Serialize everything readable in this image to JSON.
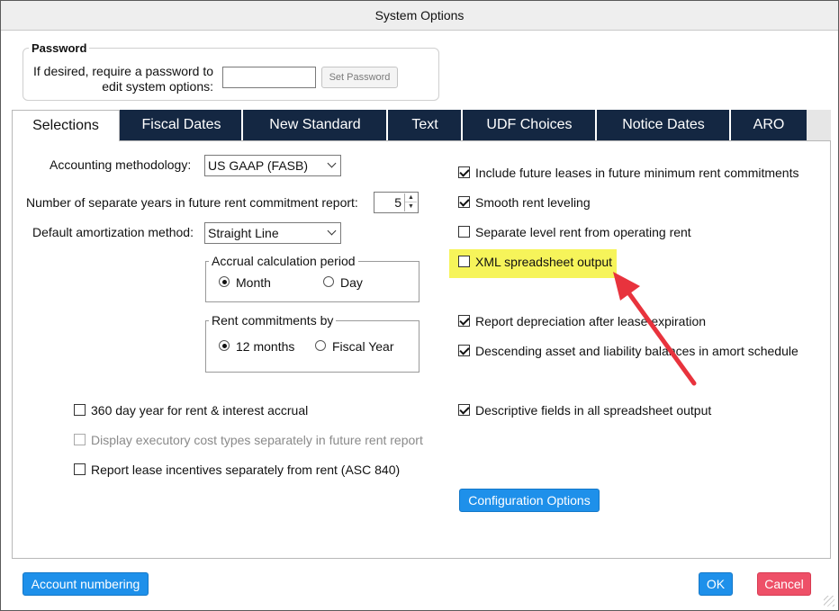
{
  "window": {
    "title": "System Options"
  },
  "password": {
    "legend": "Password",
    "label_line1": "If desired, require a password to",
    "label_line2": "edit system options:",
    "value": "",
    "set_button": "Set Password"
  },
  "tabs": [
    {
      "label": "Selections",
      "active": true
    },
    {
      "label": "Fiscal Dates",
      "active": false
    },
    {
      "label": "New Standard",
      "active": false
    },
    {
      "label": "Text",
      "active": false
    },
    {
      "label": "UDF Choices",
      "active": false
    },
    {
      "label": "Notice Dates",
      "active": false
    },
    {
      "label": "ARO",
      "active": false
    }
  ],
  "left": {
    "accounting_label": "Accounting methodology:",
    "accounting_value": "US GAAP (FASB)",
    "years_label": "Number of separate years in future rent commitment report:",
    "years_value": "5",
    "amort_label": "Default amortization method:",
    "amort_value": "Straight Line",
    "accrual_group": {
      "legend": "Accrual calculation period",
      "options": [
        {
          "label": "Month",
          "selected": true
        },
        {
          "label": "Day",
          "selected": false
        }
      ]
    },
    "rent_group": {
      "legend": "Rent commitments by",
      "options": [
        {
          "label": "12 months",
          "selected": true
        },
        {
          "label": "Fiscal Year",
          "selected": false
        }
      ]
    },
    "checks": [
      {
        "label": "360 day year for rent & interest accrual",
        "checked": false,
        "disabled": false
      },
      {
        "label": "Display executory cost types separately in future rent report",
        "checked": false,
        "disabled": true
      },
      {
        "label": "Report lease incentives separately from rent (ASC 840)",
        "checked": false,
        "disabled": false
      }
    ]
  },
  "right": {
    "checks": [
      {
        "label": "Include future leases in future minimum rent commitments",
        "checked": true
      },
      {
        "label": "Smooth rent leveling",
        "checked": true
      },
      {
        "label": "Separate level rent from operating rent",
        "checked": false
      },
      {
        "label": "XML spreadsheet output",
        "checked": false
      },
      {
        "label": "Report depreciation after lease expiration",
        "checked": true
      },
      {
        "label": "Descending asset and liability balances in amort schedule",
        "checked": true
      },
      {
        "label": "Descriptive fields in all spreadsheet output",
        "checked": true
      }
    ],
    "config_button": "Configuration Options"
  },
  "footer": {
    "account_button": "Account numbering",
    "ok_button": "OK",
    "cancel_button": "Cancel"
  },
  "colors": {
    "tab_bg": "#142742",
    "highlight": "#f6f45a",
    "arrow": "#e8333d",
    "primary_button": "#1e90ea",
    "cancel_button": "#ee5068"
  }
}
